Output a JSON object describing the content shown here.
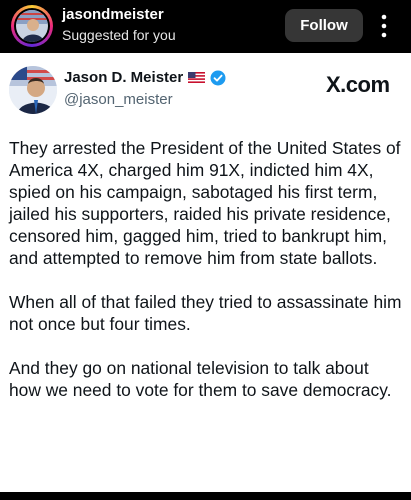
{
  "post_header": {
    "username": "jasondmeister",
    "subtitle": "Suggested for you",
    "follow_label": "Follow",
    "more_icon": "more-vertical-icon"
  },
  "tweet": {
    "display_name": "Jason D. Meister",
    "handle": "@jason_meister",
    "verified_color": "#1d9bf0",
    "brand": "X.com",
    "paragraphs": [
      "They arrested the President of the United States of America 4X, charged him 91X, indicted him 4X, spied on his campaign, sabotaged his first term, jailed his supporters, raided his private residence, censored him, gagged him, tried to bankrupt him, and attempted to remove him from state ballots.",
      "When all of that failed they tried to assassinate him not once but four times.",
      "And they go on national television to talk about how we need to vote for them to save democracy."
    ]
  }
}
